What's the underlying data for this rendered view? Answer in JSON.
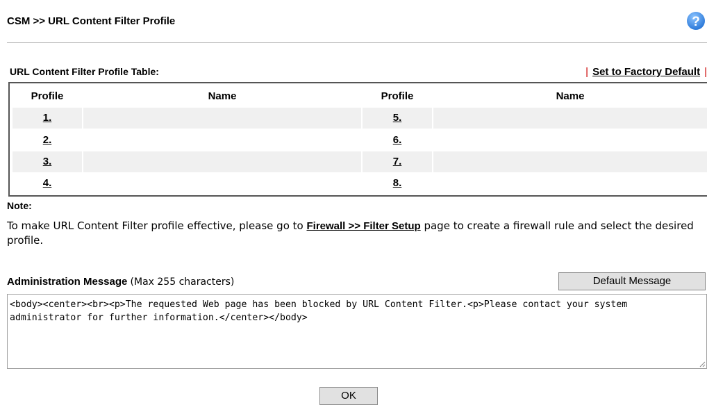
{
  "header": {
    "title": "CSM >> URL Content Filter Profile",
    "help_icon": "help-question-icon"
  },
  "table": {
    "title": "URL Content Filter Profile Table:",
    "factory_default_label": "Set to Factory Default",
    "headers": [
      "Profile",
      "Name",
      "Profile",
      "Name"
    ],
    "rows": [
      {
        "left_profile": "1.",
        "left_name": "",
        "right_profile": "5.",
        "right_name": ""
      },
      {
        "left_profile": "2.",
        "left_name": "",
        "right_profile": "6.",
        "right_name": ""
      },
      {
        "left_profile": "3.",
        "left_name": "",
        "right_profile": "7.",
        "right_name": ""
      },
      {
        "left_profile": "4.",
        "left_name": "",
        "right_profile": "8.",
        "right_name": ""
      }
    ]
  },
  "note": {
    "label": "Note:",
    "text_before": "To make URL Content Filter profile effective, please go to ",
    "link": "Firewall >> Filter Setup",
    "text_after": " page to create a firewall rule and select the desired profile."
  },
  "admin": {
    "label": "Administration Message",
    "max_hint": "(Max 255 characters)",
    "default_button": "Default Message",
    "message": "<body><center><br><p>The requested Web page has been blocked by URL Content Filter.<p>Please contact your system administrator for further information.</center></body>"
  },
  "ok_button": "OK",
  "colors": {
    "pipe": "#cc0000",
    "help_icon": "#3a8ee6",
    "row_shade": "#f0f0f0"
  }
}
